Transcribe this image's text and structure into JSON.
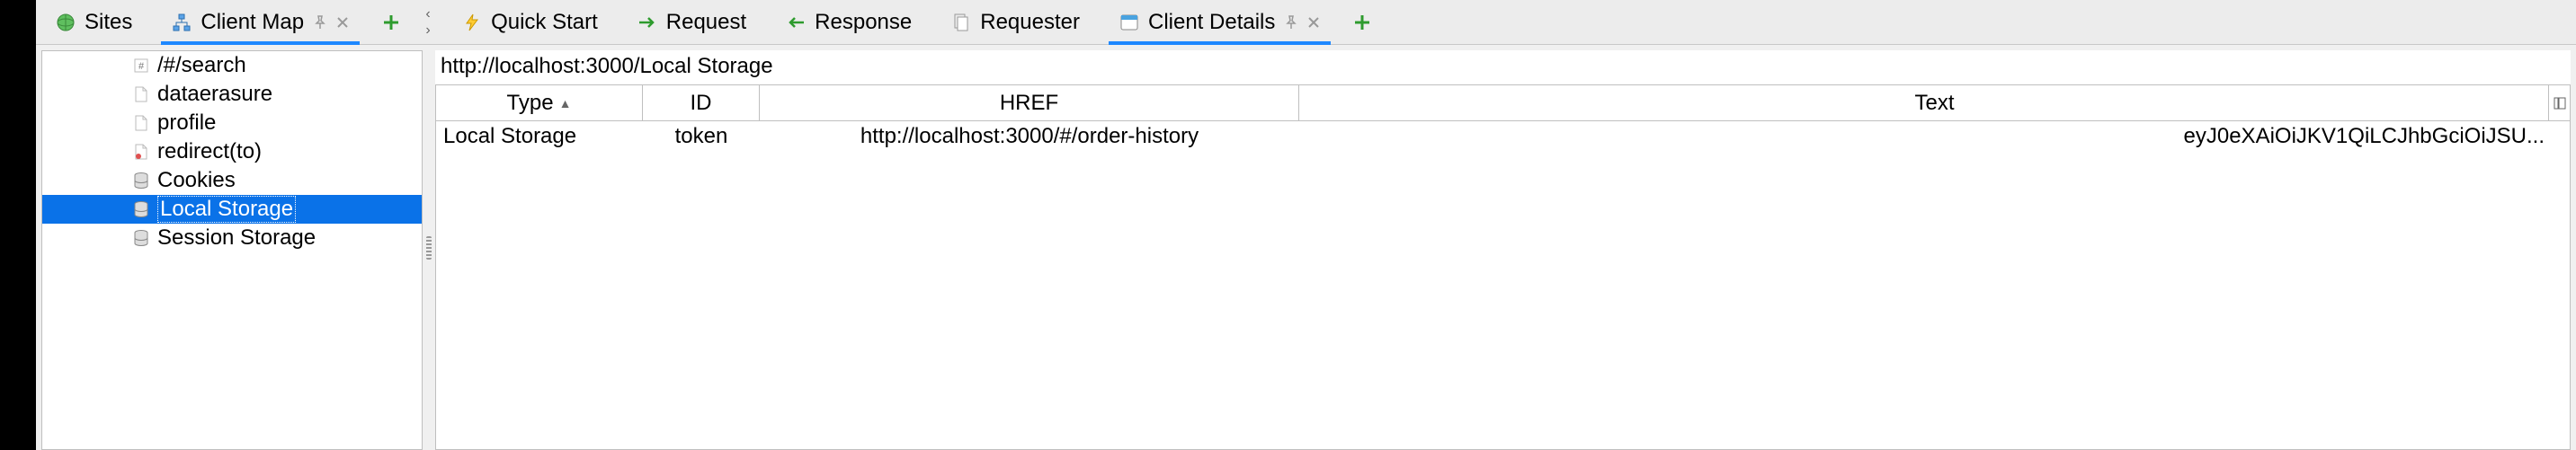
{
  "left_tabs": {
    "sites": {
      "label": "Sites"
    },
    "client_map": {
      "label": "Client Map"
    }
  },
  "right_tabs": {
    "quick_start": {
      "label": "Quick Start"
    },
    "request": {
      "label": "Request"
    },
    "response": {
      "label": "Response"
    },
    "requester": {
      "label": "Requester"
    },
    "client_details": {
      "label": "Client Details"
    }
  },
  "tree": {
    "items": [
      {
        "label": "/#/search",
        "icon": "hash"
      },
      {
        "label": "dataerasure",
        "icon": "file"
      },
      {
        "label": "profile",
        "icon": "file"
      },
      {
        "label": "redirect(to)",
        "icon": "file-red"
      },
      {
        "label": "Cookies",
        "icon": "db"
      },
      {
        "label": "Local Storage",
        "icon": "db",
        "selected": true
      },
      {
        "label": "Session Storage",
        "icon": "db"
      }
    ]
  },
  "breadcrumb": {
    "path": "http://localhost:3000/Local Storage"
  },
  "table": {
    "columns": {
      "type": "Type",
      "id": "ID",
      "href": "HREF",
      "text": "Text"
    },
    "sort_column": "type",
    "sort_dir": "asc",
    "rows": [
      {
        "type": "Local Storage",
        "id": "token",
        "href": "http://localhost:3000/#/order-history",
        "text": "eyJ0eXAiOiJKV1QiLCJhbGciOiJSU..."
      }
    ]
  },
  "chart_data": {
    "type": "table",
    "title": "http://localhost:3000/Local Storage",
    "columns": [
      "Type",
      "ID",
      "HREF",
      "Text"
    ],
    "rows": [
      [
        "Local Storage",
        "token",
        "http://localhost:3000/#/order-history",
        "eyJ0eXAiOiJKV1QiLCJhbGciOiJSU..."
      ]
    ]
  }
}
